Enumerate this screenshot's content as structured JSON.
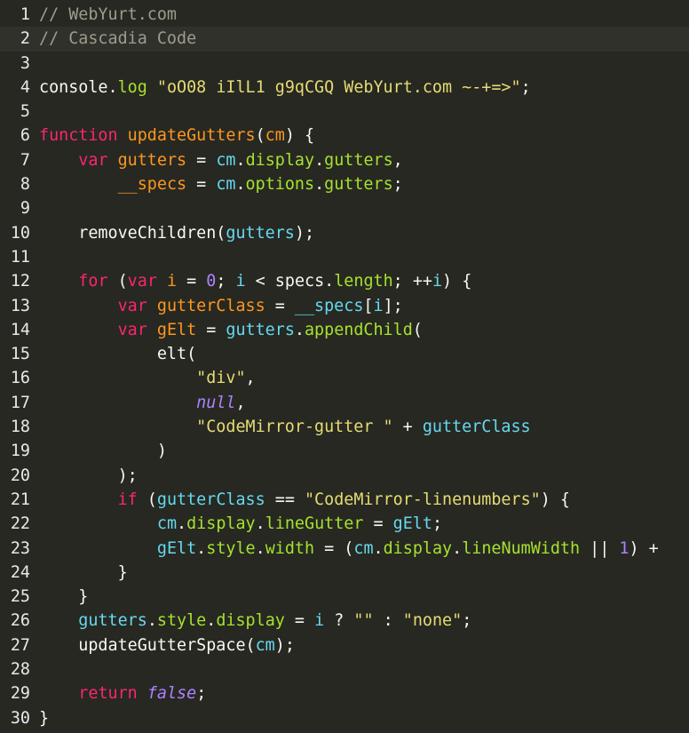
{
  "editor": {
    "theme_colors": {
      "background": "#272822",
      "active_line": "#30312b",
      "comment": "#9e9c8c",
      "keyword": "#f92672",
      "def": "#fd971f",
      "property": "#a6e22e",
      "variable": "#66d9ef",
      "string": "#e6db74",
      "number": "#ae81ff",
      "default": "#f8f8f2"
    },
    "active_line": 2,
    "lines": [
      {
        "n": "1",
        "tokens": [
          {
            "t": "comment",
            "v": "// WebYurt.com"
          }
        ]
      },
      {
        "n": "2",
        "tokens": [
          {
            "t": "comment",
            "v": "// Cascadia Code"
          }
        ]
      },
      {
        "n": "3",
        "tokens": []
      },
      {
        "n": "4",
        "tokens": [
          {
            "t": "default",
            "v": "console"
          },
          {
            "t": "default",
            "v": "."
          },
          {
            "t": "prop",
            "v": "log"
          },
          {
            "t": "default",
            "v": " "
          },
          {
            "t": "string",
            "v": "\"oO08 iIlL1 g9qCGQ WebYurt.com ~-+=>\""
          },
          {
            "t": "default",
            "v": ";"
          }
        ]
      },
      {
        "n": "5",
        "tokens": []
      },
      {
        "n": "6",
        "tokens": [
          {
            "t": "keyword",
            "v": "function"
          },
          {
            "t": "default",
            "v": " "
          },
          {
            "t": "def",
            "v": "updateGutters"
          },
          {
            "t": "default",
            "v": "("
          },
          {
            "t": "def",
            "v": "cm"
          },
          {
            "t": "default",
            "v": ") {"
          }
        ]
      },
      {
        "n": "7",
        "tokens": [
          {
            "t": "default",
            "v": "    "
          },
          {
            "t": "keyword",
            "v": "var"
          },
          {
            "t": "default",
            "v": " "
          },
          {
            "t": "def",
            "v": "gutters"
          },
          {
            "t": "default",
            "v": " = "
          },
          {
            "t": "var",
            "v": "cm"
          },
          {
            "t": "default",
            "v": "."
          },
          {
            "t": "prop",
            "v": "display"
          },
          {
            "t": "default",
            "v": "."
          },
          {
            "t": "prop",
            "v": "gutters"
          },
          {
            "t": "default",
            "v": ","
          }
        ]
      },
      {
        "n": "8",
        "tokens": [
          {
            "t": "default",
            "v": "        "
          },
          {
            "t": "def",
            "v": "__specs"
          },
          {
            "t": "default",
            "v": " = "
          },
          {
            "t": "var",
            "v": "cm"
          },
          {
            "t": "default",
            "v": "."
          },
          {
            "t": "prop",
            "v": "options"
          },
          {
            "t": "default",
            "v": "."
          },
          {
            "t": "prop",
            "v": "gutters"
          },
          {
            "t": "default",
            "v": ";"
          }
        ]
      },
      {
        "n": "9",
        "tokens": []
      },
      {
        "n": "10",
        "tokens": [
          {
            "t": "default",
            "v": "    removeChildren("
          },
          {
            "t": "var",
            "v": "gutters"
          },
          {
            "t": "default",
            "v": ");"
          }
        ]
      },
      {
        "n": "11",
        "tokens": []
      },
      {
        "n": "12",
        "tokens": [
          {
            "t": "default",
            "v": "    "
          },
          {
            "t": "keyword",
            "v": "for"
          },
          {
            "t": "default",
            "v": " ("
          },
          {
            "t": "keyword",
            "v": "var"
          },
          {
            "t": "default",
            "v": " "
          },
          {
            "t": "def",
            "v": "i"
          },
          {
            "t": "default",
            "v": " = "
          },
          {
            "t": "number",
            "v": "0"
          },
          {
            "t": "default",
            "v": "; "
          },
          {
            "t": "var",
            "v": "i"
          },
          {
            "t": "default",
            "v": " < specs."
          },
          {
            "t": "prop",
            "v": "length"
          },
          {
            "t": "default",
            "v": "; ++"
          },
          {
            "t": "var",
            "v": "i"
          },
          {
            "t": "default",
            "v": ") {"
          }
        ]
      },
      {
        "n": "13",
        "tokens": [
          {
            "t": "default",
            "v": "        "
          },
          {
            "t": "keyword",
            "v": "var"
          },
          {
            "t": "default",
            "v": " "
          },
          {
            "t": "def",
            "v": "gutterClass"
          },
          {
            "t": "default",
            "v": " = "
          },
          {
            "t": "var",
            "v": "__specs"
          },
          {
            "t": "default",
            "v": "["
          },
          {
            "t": "var",
            "v": "i"
          },
          {
            "t": "default",
            "v": "];"
          }
        ]
      },
      {
        "n": "14",
        "tokens": [
          {
            "t": "default",
            "v": "        "
          },
          {
            "t": "keyword",
            "v": "var"
          },
          {
            "t": "default",
            "v": " "
          },
          {
            "t": "def",
            "v": "gElt"
          },
          {
            "t": "default",
            "v": " = "
          },
          {
            "t": "var",
            "v": "gutters"
          },
          {
            "t": "default",
            "v": "."
          },
          {
            "t": "prop",
            "v": "appendChild"
          },
          {
            "t": "default",
            "v": "("
          }
        ]
      },
      {
        "n": "15",
        "tokens": [
          {
            "t": "default",
            "v": "            elt("
          }
        ]
      },
      {
        "n": "16",
        "tokens": [
          {
            "t": "default",
            "v": "                "
          },
          {
            "t": "string",
            "v": "\"div\""
          },
          {
            "t": "default",
            "v": ","
          }
        ]
      },
      {
        "n": "17",
        "tokens": [
          {
            "t": "default",
            "v": "                "
          },
          {
            "t": "atom",
            "v": "null"
          },
          {
            "t": "default",
            "v": ","
          }
        ]
      },
      {
        "n": "18",
        "tokens": [
          {
            "t": "default",
            "v": "                "
          },
          {
            "t": "string",
            "v": "\"CodeMirror-gutter \""
          },
          {
            "t": "default",
            "v": " + "
          },
          {
            "t": "var",
            "v": "gutterClass"
          }
        ]
      },
      {
        "n": "19",
        "tokens": [
          {
            "t": "default",
            "v": "            )"
          }
        ]
      },
      {
        "n": "20",
        "tokens": [
          {
            "t": "default",
            "v": "        );"
          }
        ]
      },
      {
        "n": "21",
        "tokens": [
          {
            "t": "default",
            "v": "        "
          },
          {
            "t": "keyword",
            "v": "if"
          },
          {
            "t": "default",
            "v": " ("
          },
          {
            "t": "var",
            "v": "gutterClass"
          },
          {
            "t": "default",
            "v": " == "
          },
          {
            "t": "string",
            "v": "\"CodeMirror-linenumbers\""
          },
          {
            "t": "default",
            "v": ") {"
          }
        ]
      },
      {
        "n": "22",
        "tokens": [
          {
            "t": "default",
            "v": "            "
          },
          {
            "t": "var",
            "v": "cm"
          },
          {
            "t": "default",
            "v": "."
          },
          {
            "t": "prop",
            "v": "display"
          },
          {
            "t": "default",
            "v": "."
          },
          {
            "t": "prop",
            "v": "lineGutter"
          },
          {
            "t": "default",
            "v": " = "
          },
          {
            "t": "var",
            "v": "gElt"
          },
          {
            "t": "default",
            "v": ";"
          }
        ]
      },
      {
        "n": "23",
        "tokens": [
          {
            "t": "default",
            "v": "            "
          },
          {
            "t": "var",
            "v": "gElt"
          },
          {
            "t": "default",
            "v": "."
          },
          {
            "t": "prop",
            "v": "style"
          },
          {
            "t": "default",
            "v": "."
          },
          {
            "t": "prop",
            "v": "width"
          },
          {
            "t": "default",
            "v": " = ("
          },
          {
            "t": "var",
            "v": "cm"
          },
          {
            "t": "default",
            "v": "."
          },
          {
            "t": "prop",
            "v": "display"
          },
          {
            "t": "default",
            "v": "."
          },
          {
            "t": "prop",
            "v": "lineNumWidth"
          },
          {
            "t": "default",
            "v": " || "
          },
          {
            "t": "number",
            "v": "1"
          },
          {
            "t": "default",
            "v": ") +"
          }
        ]
      },
      {
        "n": "24",
        "tokens": [
          {
            "t": "default",
            "v": "        }"
          }
        ]
      },
      {
        "n": "25",
        "tokens": [
          {
            "t": "default",
            "v": "    }"
          }
        ]
      },
      {
        "n": "26",
        "tokens": [
          {
            "t": "default",
            "v": "    "
          },
          {
            "t": "var",
            "v": "gutters"
          },
          {
            "t": "default",
            "v": "."
          },
          {
            "t": "prop",
            "v": "style"
          },
          {
            "t": "default",
            "v": "."
          },
          {
            "t": "prop",
            "v": "display"
          },
          {
            "t": "default",
            "v": " = "
          },
          {
            "t": "var",
            "v": "i"
          },
          {
            "t": "default",
            "v": " ? "
          },
          {
            "t": "string",
            "v": "\"\""
          },
          {
            "t": "default",
            "v": " : "
          },
          {
            "t": "string",
            "v": "\"none\""
          },
          {
            "t": "default",
            "v": ";"
          }
        ]
      },
      {
        "n": "27",
        "tokens": [
          {
            "t": "default",
            "v": "    updateGutterSpace("
          },
          {
            "t": "var",
            "v": "cm"
          },
          {
            "t": "default",
            "v": ");"
          }
        ]
      },
      {
        "n": "28",
        "tokens": []
      },
      {
        "n": "29",
        "tokens": [
          {
            "t": "default",
            "v": "    "
          },
          {
            "t": "keyword",
            "v": "return"
          },
          {
            "t": "default",
            "v": " "
          },
          {
            "t": "atom",
            "v": "false"
          },
          {
            "t": "default",
            "v": ";"
          }
        ]
      },
      {
        "n": "30",
        "tokens": [
          {
            "t": "default",
            "v": "}"
          }
        ]
      }
    ]
  }
}
